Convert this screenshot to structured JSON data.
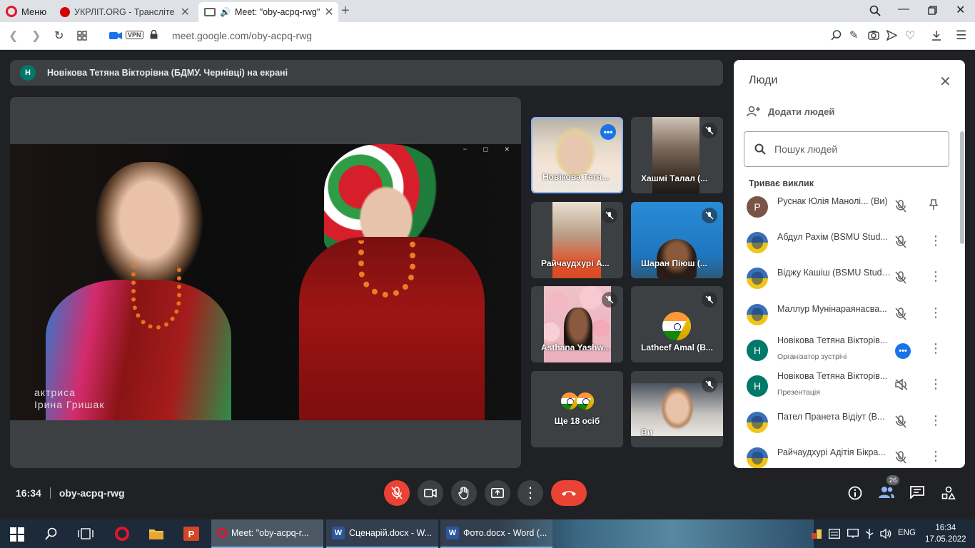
{
  "browser": {
    "menu_label": "Меню",
    "tabs": [
      {
        "title": "УКРЛІТ.ORG - Транслітера"
      },
      {
        "title": "Meet: \"oby-acpq-rwg\""
      }
    ],
    "url": "meet.google.com/oby-acpq-rwg",
    "vpn_label": "VPN"
  },
  "meet": {
    "presenting_initial": "Н",
    "presenting_text": "Новікова Тетяна Вікторівна (БДМУ. Чернівці) на екрані",
    "caption_line1": "актриса",
    "caption_line2": "Ірина Гришак",
    "tiles": [
      {
        "name": "Новікова Тетя..."
      },
      {
        "name": "Хашмі Талал (..."
      },
      {
        "name": "Райчаудхурі А..."
      },
      {
        "name": "Шаран Піюш (..."
      },
      {
        "name": "Asthana Yashw..."
      },
      {
        "name": "Latheef Amal (B..."
      },
      {
        "name": "Ще 18 осіб"
      },
      {
        "name": "Ви"
      }
    ],
    "meeting_time": "16:34",
    "meeting_code": "oby-acpq-rwg",
    "participants_count": "26"
  },
  "people_panel": {
    "title": "Люди",
    "add_people_label": "Додати людей",
    "search_placeholder": "Пошук людей",
    "section_label": "Триває виклик",
    "participants": [
      {
        "initial": "Р",
        "name": "Руснак Юлія Манолі... (Ви)",
        "subtitle": ""
      },
      {
        "initial": "",
        "name": "Абдул Рахім (BSMU Stud...",
        "subtitle": ""
      },
      {
        "initial": "",
        "name": "Віджу Кашіш (BSMU Stude...",
        "subtitle": ""
      },
      {
        "initial": "",
        "name": "Маллур Мунінараянасва...",
        "subtitle": ""
      },
      {
        "initial": "Н",
        "name": "Новікова Тетяна Вікторів...",
        "subtitle": "Організатор зустрічі"
      },
      {
        "initial": "Н",
        "name": "Новікова Тетяна Вікторів...",
        "subtitle": "Презентація"
      },
      {
        "initial": "",
        "name": "Пател Пранета Відіут (В...",
        "subtitle": ""
      },
      {
        "initial": "",
        "name": "Райчаудхурі Адітія Бікра...",
        "subtitle": ""
      }
    ]
  },
  "taskbar": {
    "items": [
      {
        "label": "Meet: \"oby-acpq-r..."
      },
      {
        "label": "Сценарій.docx - W..."
      },
      {
        "label": "Фото.docx - Word (..."
      }
    ],
    "word_letter": "W",
    "language": "ENG",
    "time": "16:34",
    "date": "17.05.2022"
  },
  "colors": {
    "meet_bg": "#202124",
    "tile_bg": "#3c4043",
    "end_call_red": "#ea4335",
    "accent_blue": "#1a73e8"
  }
}
